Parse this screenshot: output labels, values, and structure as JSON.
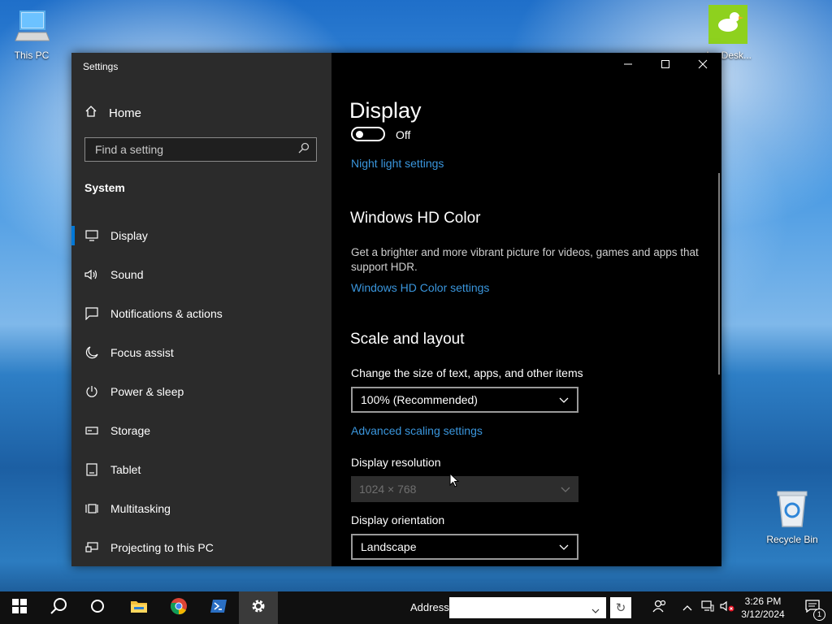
{
  "desktop": {
    "icons": {
      "this_pc": "This PC",
      "anydesk": "AnyDesk...",
      "recycle_bin": "Recycle Bin"
    }
  },
  "window": {
    "title": "Settings",
    "controls": {
      "minimize": "minimize-icon",
      "maximize": "maximize-icon",
      "close": "close-icon"
    }
  },
  "sidebar": {
    "home_label": "Home",
    "search_placeholder": "Find a setting",
    "section": "System",
    "items": [
      {
        "label": "Display",
        "icon": "monitor-icon",
        "active": true
      },
      {
        "label": "Sound",
        "icon": "speaker-icon"
      },
      {
        "label": "Notifications & actions",
        "icon": "notification-icon"
      },
      {
        "label": "Focus assist",
        "icon": "moon-icon"
      },
      {
        "label": "Power & sleep",
        "icon": "power-icon"
      },
      {
        "label": "Storage",
        "icon": "storage-icon"
      },
      {
        "label": "Tablet",
        "icon": "tablet-icon"
      },
      {
        "label": "Multitasking",
        "icon": "multitasking-icon"
      },
      {
        "label": "Projecting to this PC",
        "icon": "projecting-icon"
      }
    ]
  },
  "main": {
    "title": "Display",
    "night_light_toggle": "Off",
    "night_light_link": "Night light settings",
    "hd_color": {
      "heading": "Windows HD Color",
      "description": "Get a brighter and more vibrant picture for videos, games and apps that support HDR.",
      "link": "Windows HD Color settings"
    },
    "scale_layout": {
      "heading": "Scale and layout",
      "scale_label": "Change the size of text, apps, and other items",
      "scale_value": "100% (Recommended)",
      "advanced_link": "Advanced scaling settings",
      "resolution_label": "Display resolution",
      "resolution_value": "1024 × 768",
      "orientation_label": "Display orientation",
      "orientation_value": "Landscape"
    }
  },
  "taskbar": {
    "address_label": "Address",
    "address_value": "",
    "clock_time": "3:26 PM",
    "clock_date": "3/12/2024",
    "notification_count": "1"
  },
  "colors": {
    "accent": "#0078d7",
    "link": "#3a96dd",
    "sidebar_bg": "#2b2b2b",
    "content_bg": "#000000"
  }
}
